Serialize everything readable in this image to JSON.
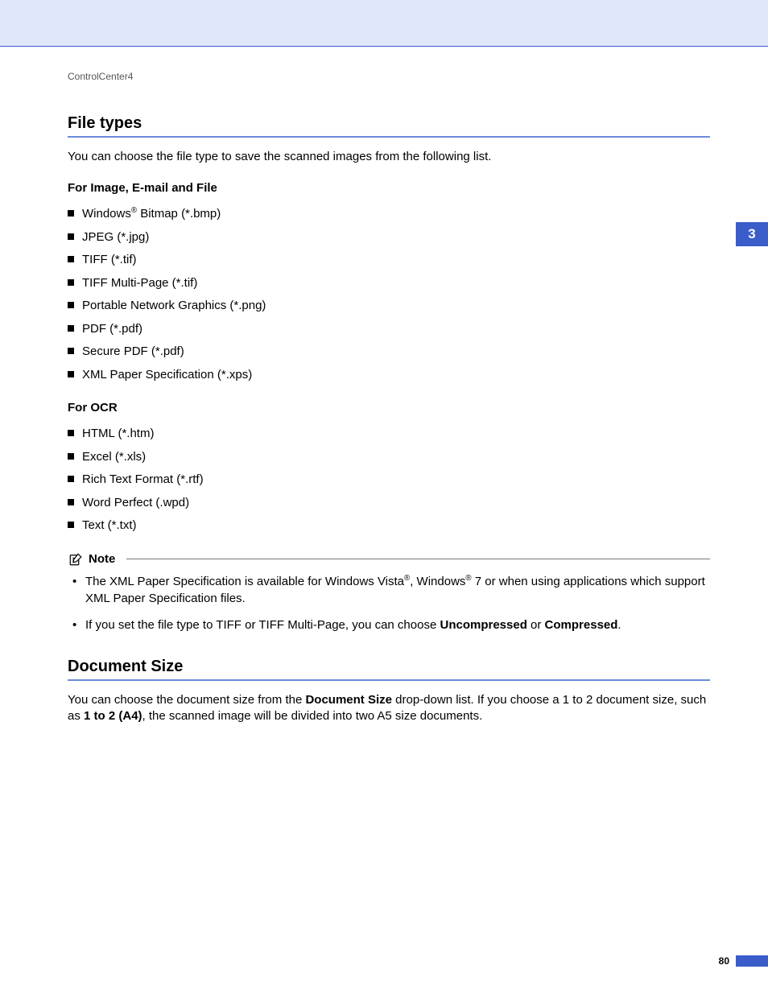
{
  "header": {
    "running": "ControlCenter4"
  },
  "tab": {
    "chapter": "3"
  },
  "section1": {
    "title": "File types",
    "intro": "You can choose the file type to save the scanned images from the following list.",
    "groupA": {
      "label": "For Image, E-mail and File",
      "items": {
        "i0a": "Windows",
        "i0b": " Bitmap (*.bmp)",
        "i1": "JPEG (*.jpg)",
        "i2": "TIFF (*.tif)",
        "i3": "TIFF Multi-Page (*.tif)",
        "i4": "Portable Network Graphics (*.png)",
        "i5": "PDF (*.pdf)",
        "i6": "Secure PDF (*.pdf)",
        "i7": "XML Paper Specification (*.xps)"
      }
    },
    "groupB": {
      "label": "For OCR",
      "items": {
        "i0": "HTML (*.htm)",
        "i1": "Excel (*.xls)",
        "i2": "Rich Text Format (*.rtf)",
        "i3": "Word Perfect (.wpd)",
        "i4": "Text (*.txt)"
      }
    }
  },
  "note": {
    "label": "Note",
    "n1a": "The XML Paper Specification is available for Windows Vista",
    "n1b": ", Windows",
    "n1c": " 7 or when using applications which support XML Paper Specification files.",
    "n2a": "If you set the file type to TIFF or TIFF Multi-Page, you can choose ",
    "n2bold1": "Uncompressed",
    "n2b": " or ",
    "n2bold2": "Compressed",
    "n2c": "."
  },
  "section2": {
    "title": "Document Size",
    "p1a": "You can choose the document size from the ",
    "p1bold1": "Document Size",
    "p1b": " drop-down list. If you choose a 1 to 2 document size, such as ",
    "p1bold2": "1 to 2 (A4)",
    "p1c": ", the scanned image will be divided into two A5 size documents."
  },
  "footer": {
    "page": "80"
  },
  "glyph": {
    "reg": "®"
  }
}
